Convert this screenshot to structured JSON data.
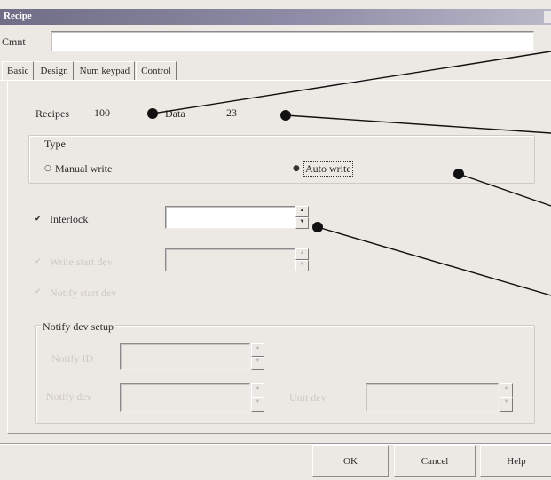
{
  "window": {
    "title": "Recipe"
  },
  "comment": {
    "label": "Cmnt",
    "value": ""
  },
  "tabs": [
    {
      "label": "Basic"
    },
    {
      "label": "Design"
    },
    {
      "label": "Num keypad"
    },
    {
      "label": "Control"
    }
  ],
  "basic": {
    "recipes_label": "Recipes",
    "recipes_value": "100",
    "data_label": "Data",
    "data_value": "23",
    "type_group": "Type",
    "manual_write": "Manual write",
    "auto_write": "Auto write",
    "interlock_label": "Interlock",
    "interlock_value": "",
    "row2_label": "Write start dev",
    "row3_label": "Notify start dev",
    "notify_group": "Notify dev setup",
    "notify_row1_label": "Notify ID",
    "notify_row2_label": "Notify dev",
    "notify_row2b_label": "Unit dev"
  },
  "buttons": {
    "ok": "OK",
    "cancel": "Cancel",
    "help": "Help"
  },
  "colors": {
    "title_bar": "#6f6e86",
    "dialog_bg": "#ece8e4",
    "disabled_text": "#cdc8c4"
  },
  "icons": {
    "checked": "check-mark-icon",
    "radio_selected": "radio-dot-icon"
  }
}
